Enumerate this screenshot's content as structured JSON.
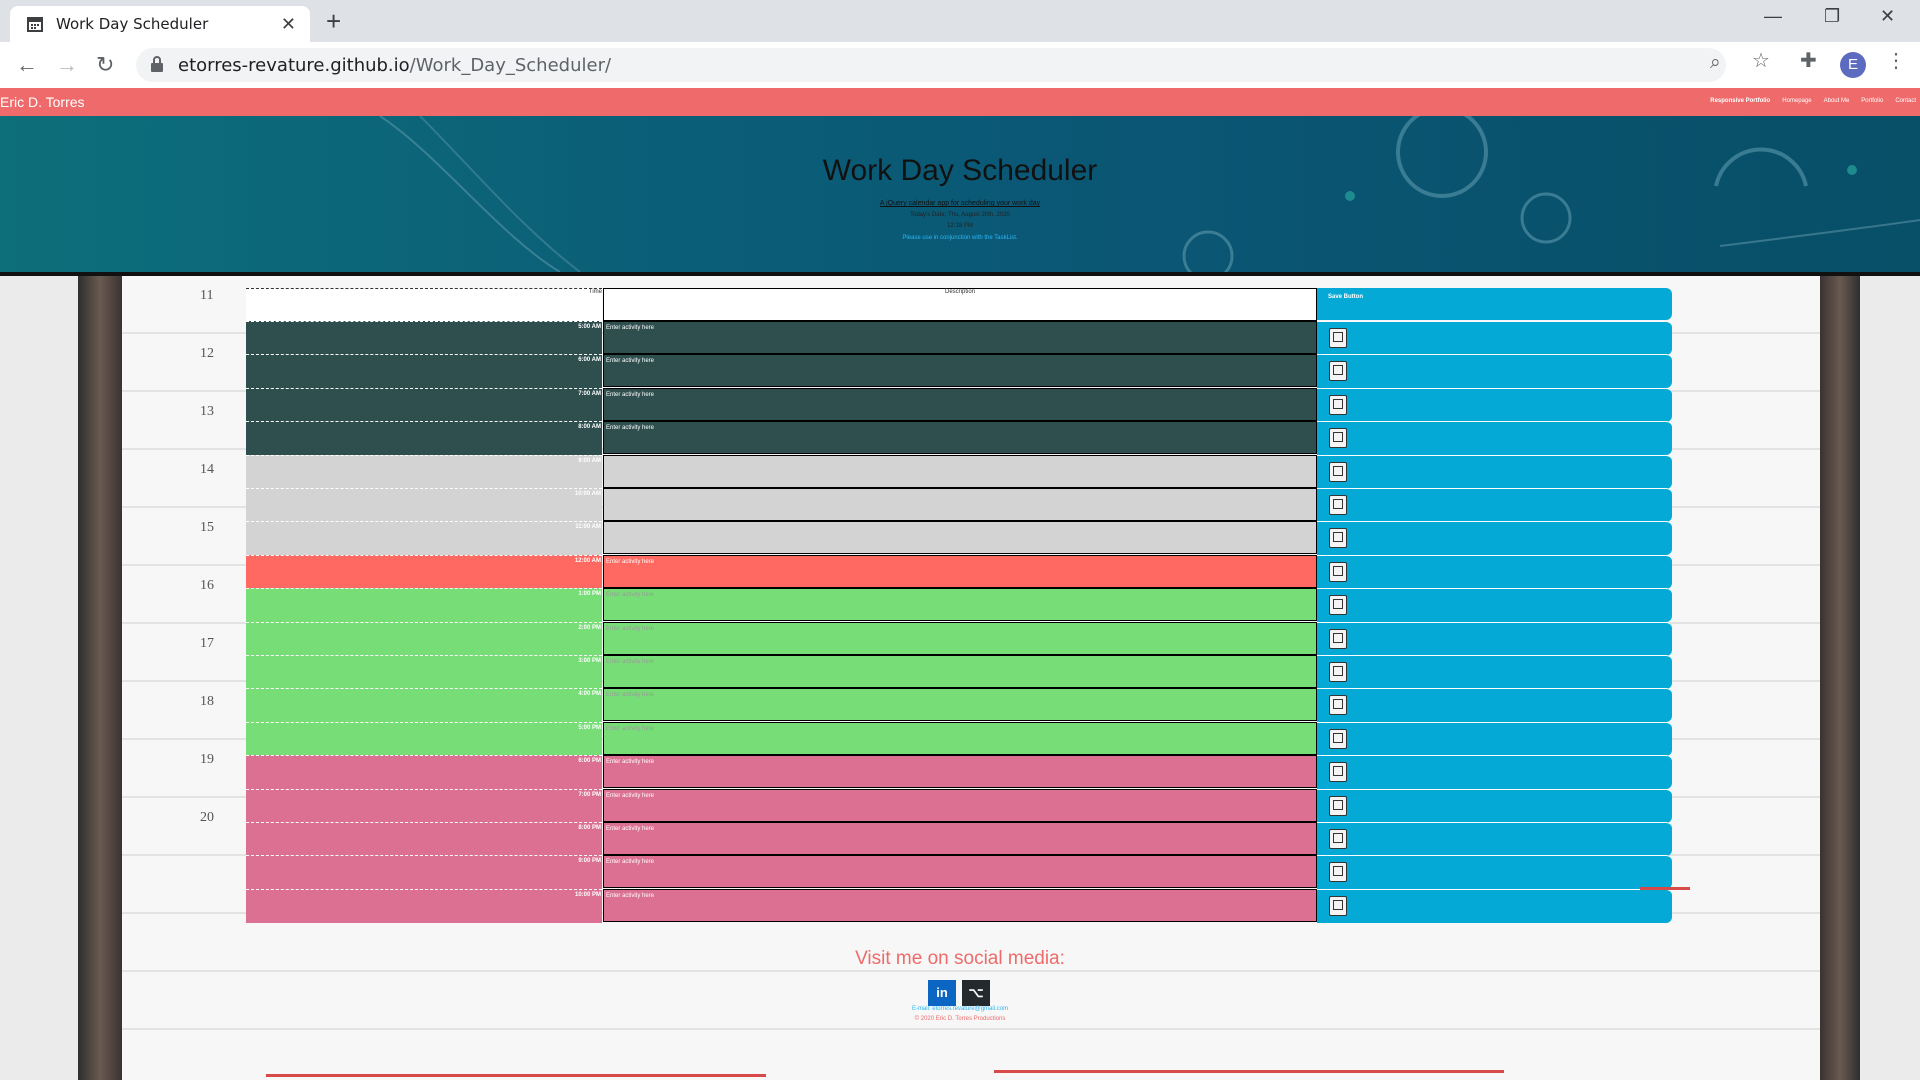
{
  "browser": {
    "tab_title": "Work Day Scheduler",
    "url_host": "etorres-revature.github.io",
    "url_path": "/Work_Day_Scheduler/",
    "avatar_letter": "E"
  },
  "navbar": {
    "brand": "Eric D. Torres",
    "links": [
      "Responsive Portfolio",
      "Homepage",
      "About Me",
      "Portfolio",
      "Contact"
    ]
  },
  "hero": {
    "title": "Work Day Scheduler",
    "subtitle": "A jQuery calendar app for scheduling your work day",
    "date": "Today's Date: Thu, August 20th, 2020",
    "time": "12:18 PM",
    "link": "Please use in conjunction with the TaskList."
  },
  "scheduler": {
    "header": {
      "time": "Time",
      "description": "Description",
      "save": "Save Button"
    },
    "rows": [
      {
        "time": "5:00 AM",
        "placeholder": "Enter activity here",
        "state": "past"
      },
      {
        "time": "6:00 AM",
        "placeholder": "Enter activity here",
        "state": "past"
      },
      {
        "time": "7:00 AM",
        "placeholder": "Enter activity here",
        "state": "past"
      },
      {
        "time": "8:00 AM",
        "placeholder": "Enter activity here",
        "state": "past"
      },
      {
        "time": "9:00 AM",
        "placeholder": "",
        "state": "gray"
      },
      {
        "time": "10:00 AM",
        "placeholder": "",
        "state": "gray"
      },
      {
        "time": "11:00 AM",
        "placeholder": "",
        "state": "gray"
      },
      {
        "time": "12:00 AM",
        "placeholder": "Enter activity here",
        "state": "present"
      },
      {
        "time": "1:00 PM",
        "placeholder": "Enter activity here",
        "state": "future"
      },
      {
        "time": "2:00 PM",
        "placeholder": "Enter activity here",
        "state": "future"
      },
      {
        "time": "3:00 PM",
        "placeholder": "Enter activity here",
        "state": "future"
      },
      {
        "time": "4:00 PM",
        "placeholder": "Enter activity here",
        "state": "future"
      },
      {
        "time": "5:00 PM",
        "placeholder": "Enter activity here",
        "state": "future"
      },
      {
        "time": "6:00 PM",
        "placeholder": "Enter activity here",
        "state": "pink"
      },
      {
        "time": "7:00 PM",
        "placeholder": "Enter activity here",
        "state": "pink"
      },
      {
        "time": "8:00 PM",
        "placeholder": "Enter activity here",
        "state": "pink"
      },
      {
        "time": "9:00 PM",
        "placeholder": "Enter activity here",
        "state": "pink"
      },
      {
        "time": "10:00 PM",
        "placeholder": "Enter activity here",
        "state": "pink"
      }
    ]
  },
  "background_hours": [
    "11",
    "12",
    "13",
    "14",
    "15",
    "16",
    "17",
    "18",
    "19",
    "20"
  ],
  "footer": {
    "title": "Visit me on social media:",
    "linkedin": "in",
    "github": "⌥",
    "email": "E-mail: etorres.revature@gmail.com",
    "copyright": "© 2020 Eric D. Torres Productions"
  },
  "colors": {
    "navbar": "#ef6b6b",
    "save": "#05a9d6",
    "past": "#2f4f4f",
    "present": "#ff6961",
    "future": "#77dd77",
    "evening": "#db7093"
  }
}
